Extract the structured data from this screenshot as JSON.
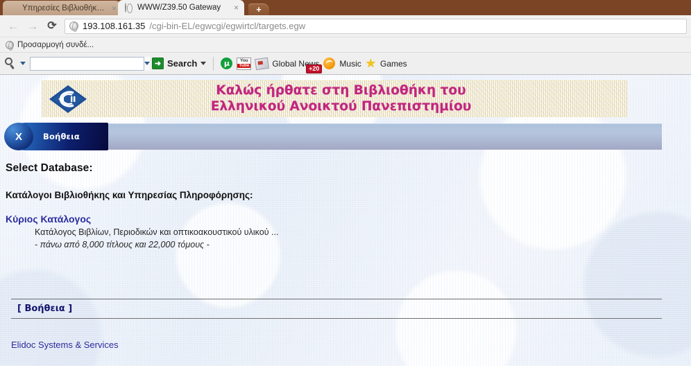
{
  "browser": {
    "tabs": [
      {
        "title": "Υπηρεσίες Βιβλιοθήκης Ελλ",
        "close": "×",
        "favicon": "diamond-favicon",
        "active": false
      },
      {
        "title": "WWW/Z39.50 Gateway",
        "close": "×",
        "favicon": "globe-favicon",
        "active": true
      }
    ],
    "new_tab_label": "+",
    "nav": {
      "back": "←",
      "forward": "→",
      "reload": "⟳"
    },
    "url": {
      "host": "193.108.161.35",
      "path": "/cgi-bin-EL/egwcgi/egwirtcl/targets.egw"
    },
    "bookmarks": [
      {
        "label": "Προσαρμογή συνδέ..."
      }
    ]
  },
  "ext_toolbar": {
    "search_placeholder": "",
    "search_value": "",
    "search_button": "Search",
    "arrow_glyph": "➜",
    "items": [
      {
        "label": "",
        "icon": "utorrent-icon"
      },
      {
        "label": "",
        "icon": "youtube-icon",
        "you": "You",
        "tube": "Tube"
      },
      {
        "label": "Global News",
        "icon": "news-icon",
        "badge": "+20"
      },
      {
        "label": "Music",
        "icon": "music-icon"
      },
      {
        "label": "Games",
        "icon": "star-icon",
        "glyph": "★"
      }
    ]
  },
  "banner": {
    "line1": "Καλώς ήρθατε στη Βιβλιοθήκη του",
    "line2": "Ελληνικού Ανοικτού Πανεπιστημίου",
    "logo_name": "eap-diamond-logo",
    "color": "#c2257f"
  },
  "navstrip": {
    "close_label": "X",
    "help_tab": "Βοήθεια"
  },
  "content": {
    "heading": "Select Database:",
    "subheading": "Κατάλογοι Βιβλιοθήκης και Υπηρεσίας Πληροφόρησης:",
    "database": {
      "link": "Κύριος Κατάλογος",
      "desc_line1": "Κατάλογος Βιβλίων, Περιοδικών και οπτικοακουστικού υλικού ...",
      "desc_line2": "- πάνω από 8,000 τίτλους και 22,000 τόμους -"
    }
  },
  "footer": {
    "help_link": "[ Βοήθεια ]",
    "credit": "Elidoc Systems & Services"
  }
}
